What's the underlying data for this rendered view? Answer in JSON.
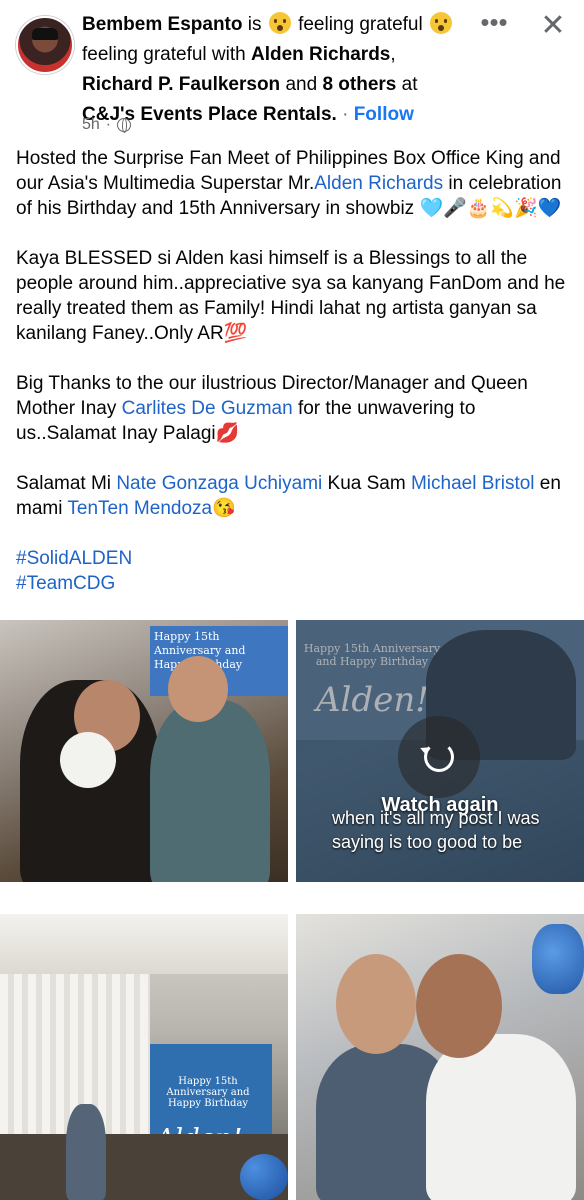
{
  "post": {
    "author": "Bembem Espanto",
    "feeling_prefix": "is",
    "feeling": "feeling grateful",
    "feeling_with_prefix": "feeling grateful with",
    "tagged_1": "Alden Richards",
    "tagged_2": "Richard P. Faulkerson",
    "and_word": "and",
    "others": "8 others",
    "at_word": "at",
    "place": "C&J's Events Place Rentals.",
    "follow": "Follow",
    "separator": "·",
    "time": "5h",
    "privacy_icon": "globe-icon",
    "more_icon": "more-dots-icon",
    "close_icon": "close-icon"
  },
  "body": {
    "p1_a": "Hosted the Surprise Fan Meet of Philippines Box Office King and our Asia's Multimedia Superstar Mr.",
    "p1_link": "Alden Richards",
    "p1_b": " in celebration of his Birthday and 15th Anniversary in showbiz 🩵🎤🎂💫🎉💙",
    "p2": "Kaya BLESSED si Alden kasi himself is a Blessings to all the people around him..appreciative sya sa kanyang FanDom and he really treated them as Family! Hindi lahat ng artista ganyan sa kanilang Faney..Only AR💯",
    "p3_a": "Big Thanks to the our ilustrious Director/Manager and Queen Mother Inay ",
    "p3_link": "Carlites De Guzman",
    "p3_b": " for the unwavering to us..Salamat Inay Palagi💋",
    "p4_a": "Salamat Mi ",
    "p4_link1": "Nate Gonzaga Uchiyami",
    "p4_b": " Kua Sam ",
    "p4_link2": "Michael Bristol",
    "p4_c": "  en mami ",
    "p4_link3": "TenTen Mendoza",
    "p4_d": "😘",
    "tag1": "#SolidALDEN",
    "tag2": "#TeamCDG"
  },
  "media": {
    "photo1_banner": "Happy 15th Anniversary and Happy Birthday",
    "photo2_banner_small": "Happy 15th Anniversary and Happy Birthday",
    "photo2_banner_script": "Alden!",
    "watch_again": "Watch again",
    "video_caption": "when it's all my post I was saying is too good to be",
    "photo3_banner_small": "Happy 15th Anniversary and Happy Birthday",
    "photo3_banner_script": "Alden!"
  },
  "colors": {
    "link": "#1e63c8",
    "follow": "#1877f2",
    "meta": "#65676b"
  }
}
